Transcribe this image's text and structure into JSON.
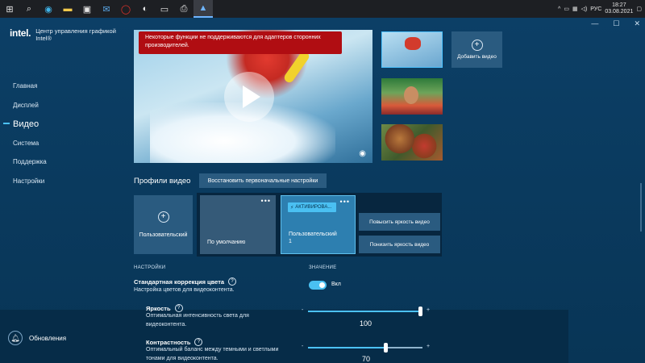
{
  "taskbar": {
    "icons": [
      "windows-icon",
      "search-icon",
      "edge-icon",
      "file-explorer-icon",
      "store-icon",
      "mail-icon",
      "opera-icon",
      "steam-icon",
      "steam-vr-icon",
      "printer-icon",
      "intel-graphics-icon"
    ],
    "tray": {
      "lang": "РУС",
      "time": "18:27",
      "date": "03.08.2021"
    }
  },
  "brand": {
    "logo": "intel.",
    "title": "Центр управления графикой Intel®"
  },
  "nav": {
    "items": [
      {
        "label": "Главная"
      },
      {
        "label": "Дисплей"
      },
      {
        "label": "Видео",
        "active": true
      },
      {
        "label": "Система"
      },
      {
        "label": "Поддержка"
      },
      {
        "label": "Настройки"
      }
    ]
  },
  "updates": {
    "label": "Обновления"
  },
  "preview": {
    "warning": "Некоторые функции не поддерживаются для адаптеров сторонних производителей."
  },
  "add_video": {
    "label": "Добавить видео",
    "plus": "+"
  },
  "profiles": {
    "title": "Профили видео",
    "reset_label": "Восстановить первоначальные настройки",
    "custom_label": "Пользовательский",
    "plus": "+",
    "cards": [
      {
        "label": "По умолчанию",
        "dots": "•••"
      },
      {
        "label": "Пользовательский 1",
        "dots": "•••",
        "badge": "АКТИВИРОВА..."
      }
    ],
    "buttons": [
      "Повысить яркость видео",
      "Понизить яркость видео"
    ]
  },
  "settings": {
    "col_settings": "НАСТРОЙКИ",
    "col_value": "ЗНАЧЕНИЕ",
    "color_correction": {
      "title": "Стандартная коррекция цвета",
      "desc": "Настройка цветов для видеоконтента.",
      "toggle_on": true,
      "toggle_label": "Вкл"
    },
    "brightness": {
      "title": "Яркость",
      "desc": "Оптимальная интенсивность света для видеоконтента.",
      "value": "100",
      "fraction": 1.0,
      "minus": "-",
      "plus": "+"
    },
    "contrast": {
      "title": "Контрастность",
      "desc": "Оптимальный баланс между темными и светлыми тонами для видеоконтента.",
      "value": "70",
      "fraction": 0.68,
      "minus": "-",
      "plus": "+"
    },
    "qmark": "?"
  },
  "window": {
    "minimize": "—",
    "maximize": "☐",
    "close": "✕"
  },
  "colors": {
    "accent": "#4cc2ff",
    "warning_bg": "#b00d12",
    "panel": "#2a5b80",
    "background": "#0b3a5c"
  }
}
